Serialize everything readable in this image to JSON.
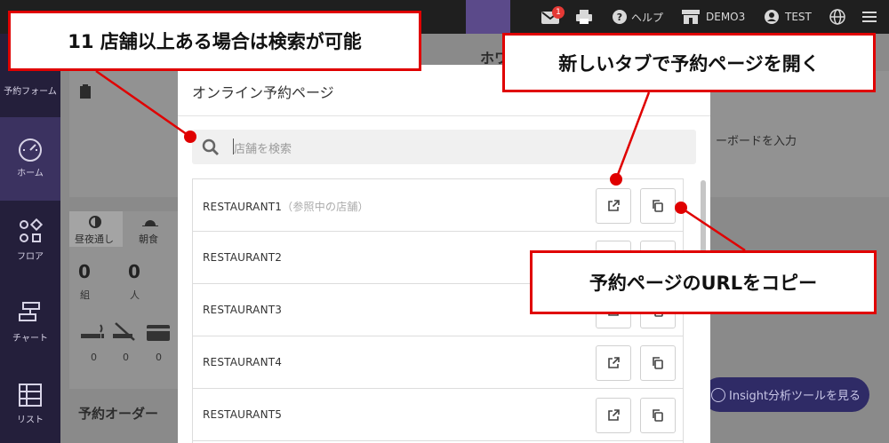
{
  "topbar": {
    "notification_count": "1",
    "help_label": "ヘルプ",
    "store_label": "DEMO3",
    "user_label": "TEST"
  },
  "sidebar": {
    "items": [
      {
        "label": "予約フォーム"
      },
      {
        "label": "ホーム"
      },
      {
        "label": "フロア"
      },
      {
        "label": "チャート"
      },
      {
        "label": "リスト"
      }
    ]
  },
  "background": {
    "header_partial": "ホワ",
    "input_hint": "ーボードを入力",
    "tabs": [
      "昼夜通し",
      "朝食"
    ],
    "counts": [
      {
        "value": "0",
        "unit": "組"
      },
      {
        "value": "0",
        "unit": "人"
      }
    ],
    "small_counts": [
      "0",
      "0",
      "0"
    ],
    "section_title": "予約オーダー",
    "insight_button": "Insight分析ツールを見る"
  },
  "modal": {
    "title": "オンライン予約ページ",
    "search_placeholder": "店舗を検索",
    "restaurants": [
      {
        "name": "RESTAURANT1",
        "note": "（参照中の店舗）"
      },
      {
        "name": "RESTAURANT2",
        "note": ""
      },
      {
        "name": "RESTAURANT3",
        "note": ""
      },
      {
        "name": "RESTAURANT4",
        "note": ""
      },
      {
        "name": "RESTAURANT5",
        "note": ""
      }
    ]
  },
  "callouts": {
    "search": "11 店舗以上ある場合は検索が可能",
    "open": "新しいタブで予約ページを開く",
    "copy": "予約ページのURLをコピー"
  },
  "colors": {
    "accent_red": "#e00000",
    "sidebar_bg": "#241f3b",
    "topbar_bg": "#1f1f1f"
  }
}
